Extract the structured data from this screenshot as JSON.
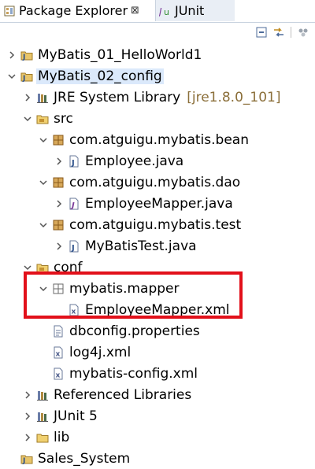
{
  "tabs": [
    {
      "label": "Package Explorer",
      "close": "⊠",
      "active": true
    },
    {
      "label": "JUnit",
      "active": false
    }
  ],
  "toolbar": {
    "icons": [
      "collapse-all-icon",
      "link-with-editor-icon",
      "view-menu-icon"
    ]
  },
  "tree": [
    {
      "label": "MyBatis_01_HelloWorld1",
      "indent": 0,
      "twisty": "collapsed",
      "icon": "java-project-icon"
    },
    {
      "label": "MyBatis_02_config",
      "indent": 0,
      "twisty": "expanded",
      "icon": "java-project-icon",
      "selected": true
    },
    {
      "label": "JRE System Library",
      "decor": "[jre1.8.0_101]",
      "indent": 1,
      "twisty": "collapsed",
      "icon": "library-icon"
    },
    {
      "label": "src",
      "indent": 1,
      "twisty": "expanded",
      "icon": "source-folder-icon"
    },
    {
      "label": "com.atguigu.mybatis.bean",
      "indent": 2,
      "twisty": "expanded",
      "icon": "package-icon"
    },
    {
      "label": "Employee.java",
      "indent": 3,
      "twisty": "collapsed",
      "icon": "java-file-icon"
    },
    {
      "label": "com.atguigu.mybatis.dao",
      "indent": 2,
      "twisty": "expanded",
      "icon": "package-icon"
    },
    {
      "label": "EmployeeMapper.java",
      "indent": 3,
      "twisty": "collapsed",
      "icon": "java-interface-file-icon"
    },
    {
      "label": "com.atguigu.mybatis.test",
      "indent": 2,
      "twisty": "expanded",
      "icon": "package-icon"
    },
    {
      "label": "MyBatisTest.java",
      "indent": 3,
      "twisty": "collapsed",
      "icon": "java-file-icon"
    },
    {
      "label": "conf",
      "indent": 1,
      "twisty": "expanded",
      "icon": "source-folder-icon"
    },
    {
      "label": "mybatis.mapper",
      "indent": 2,
      "twisty": "expanded",
      "icon": "empty-package-icon"
    },
    {
      "label": "EmployeeMapper.xml",
      "indent": 3,
      "twisty": "none",
      "icon": "xml-file-icon"
    },
    {
      "label": "dbconfig.properties",
      "indent": 2,
      "twisty": "none",
      "icon": "properties-file-icon"
    },
    {
      "label": "log4j.xml",
      "indent": 2,
      "twisty": "none",
      "icon": "xml-file-icon"
    },
    {
      "label": "mybatis-config.xml",
      "indent": 2,
      "twisty": "none",
      "icon": "xml-file-icon"
    },
    {
      "label": "Referenced Libraries",
      "indent": 1,
      "twisty": "collapsed",
      "icon": "library-icon"
    },
    {
      "label": "JUnit 5",
      "indent": 1,
      "twisty": "collapsed",
      "icon": "library-icon"
    },
    {
      "label": "lib",
      "indent": 1,
      "twisty": "collapsed",
      "icon": "folder-icon"
    },
    {
      "label": "Sales_System",
      "indent": 0,
      "twisty": "none",
      "icon": "java-project-icon"
    }
  ],
  "colors": {
    "highlight": "#e2101a",
    "selection": "#dbe9fb",
    "decoration": "#8b6f3a"
  }
}
